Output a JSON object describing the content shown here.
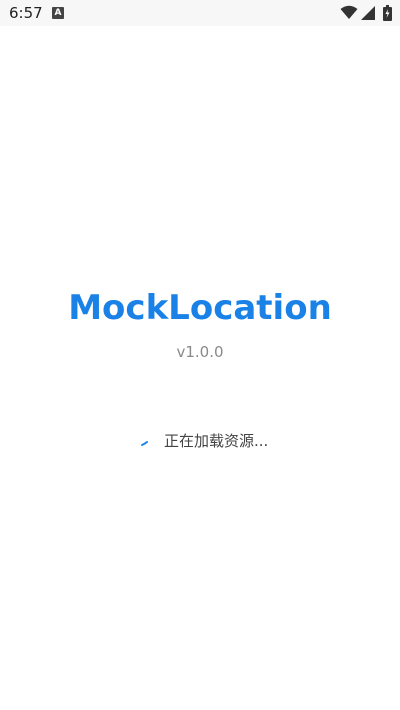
{
  "status_bar": {
    "time": "6:57",
    "notification_letter": "A",
    "icons": [
      "wifi-icon",
      "signal-icon",
      "battery-icon"
    ]
  },
  "app": {
    "title": "MockLocation",
    "version": "v1.0.0"
  },
  "loading": {
    "text": "正在加载资源..."
  },
  "colors": {
    "accent": "#1a82e6",
    "version_text": "#8a8a8a",
    "loading_text": "#444444"
  }
}
